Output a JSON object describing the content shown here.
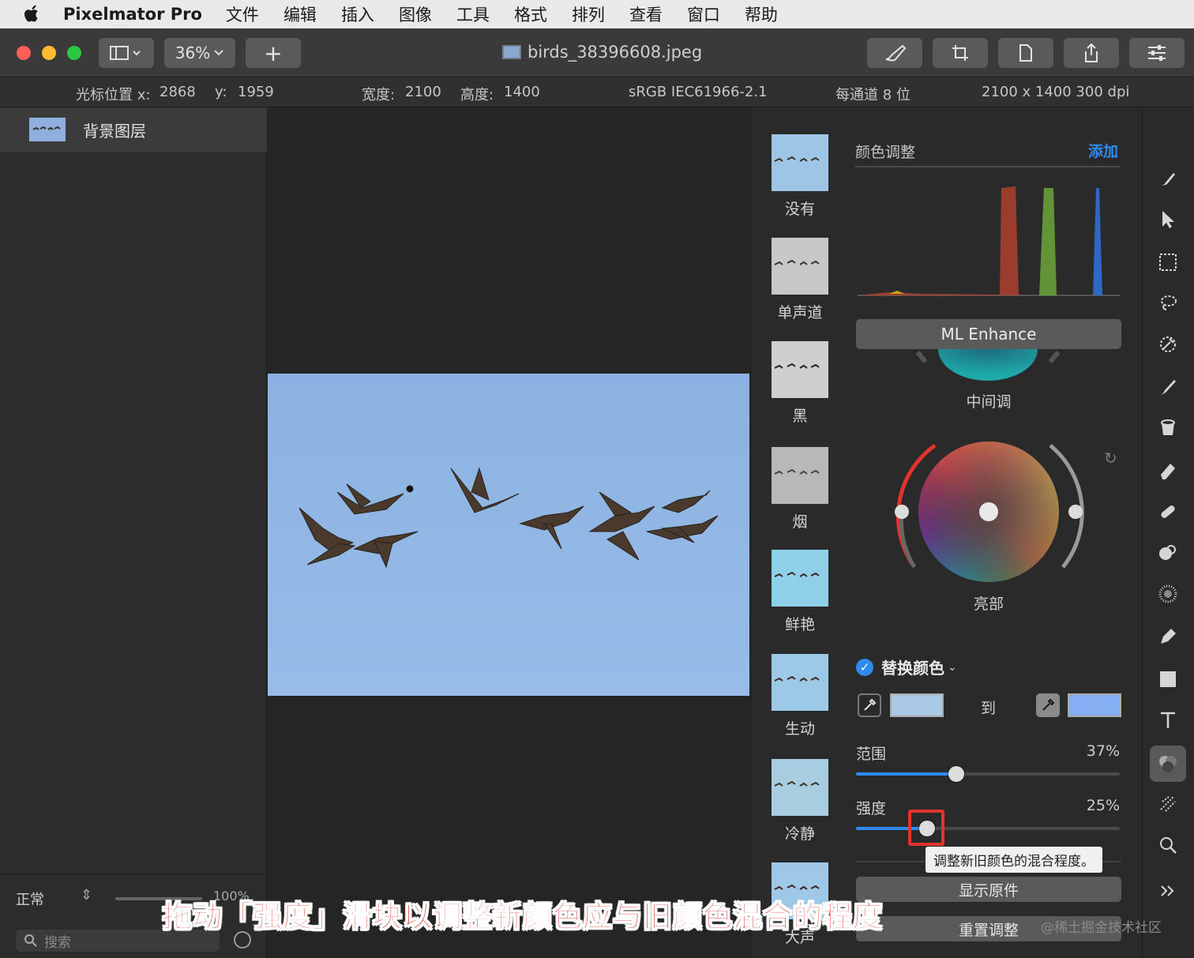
{
  "menubar": {
    "app_name": "Pixelmator Pro",
    "items": [
      "文件",
      "编辑",
      "插入",
      "图像",
      "工具",
      "格式",
      "排列",
      "查看",
      "窗口",
      "帮助"
    ]
  },
  "toolbar": {
    "zoom": "36%",
    "add_label": "+",
    "document_title": "birds_38396608.jpeg",
    "traffic_colors": [
      "#ff5f57",
      "#febc2e",
      "#28c840"
    ]
  },
  "infobar": {
    "cursor_x_label": "光标位置 x:",
    "cursor_x": "2868",
    "cursor_y_label": "y:",
    "cursor_y": "1959",
    "width_label": "宽度:",
    "width": "2100",
    "height_label": "高度:",
    "height": "1400",
    "color_profile": "sRGB IEC61966-2.1",
    "bit_depth": "每通道 8 位",
    "dimensions": "2100 x 1400 300 dpi"
  },
  "layers": {
    "items": [
      {
        "name": "背景图层"
      }
    ],
    "blend_mode": "正常",
    "opacity": "100%",
    "search_placeholder": "搜索"
  },
  "presets": {
    "items": [
      {
        "label": "没有",
        "tint": "#9ec4e6"
      },
      {
        "label": "单声道",
        "tint": "#c8c8c8"
      },
      {
        "label": "黑",
        "tint": "#cfcfcf"
      },
      {
        "label": "烟",
        "tint": "#b8b8b8"
      },
      {
        "label": "鲜艳",
        "tint": "#8ed0e8"
      },
      {
        "label": "生动",
        "tint": "#9cc9e6"
      },
      {
        "label": "冷静",
        "tint": "#a9cde0"
      },
      {
        "label": "大声",
        "tint": "#9fc7e8"
      }
    ]
  },
  "adjust": {
    "title": "颜色调整",
    "add": "添加",
    "ml_enhance": "ML Enhance",
    "midtones_label": "中间调",
    "highlights_label": "亮部",
    "replace_color": {
      "title": "替换颜色",
      "to_label": "到",
      "from_color": "#a9c9e6",
      "to_color": "#86aef2"
    },
    "range": {
      "label": "范围",
      "value": "37%",
      "fraction": 0.38
    },
    "strength": {
      "label": "强度",
      "value": "25%",
      "fraction": 0.27
    },
    "tooltip": "调整新旧颜色的混合程度。",
    "show_original": "显示原件",
    "reset": "重置调整"
  },
  "tools": [
    "brush-icon",
    "arrow-icon",
    "selection-icon",
    "lasso-icon",
    "color-picker-icon",
    "paint-icon",
    "bucket-icon",
    "eraser-icon",
    "retouch-icon",
    "clone-icon",
    "blur-icon",
    "pen-icon",
    "shape-icon",
    "text-icon",
    "color-adjust-icon",
    "effects-icon",
    "zoom-icon",
    "more-icon"
  ],
  "overlay": {
    "caption": "拖动「强度」滑块以调整新颜色应与旧颜色混合的程度",
    "watermark": "@稀土掘金技术社区"
  }
}
